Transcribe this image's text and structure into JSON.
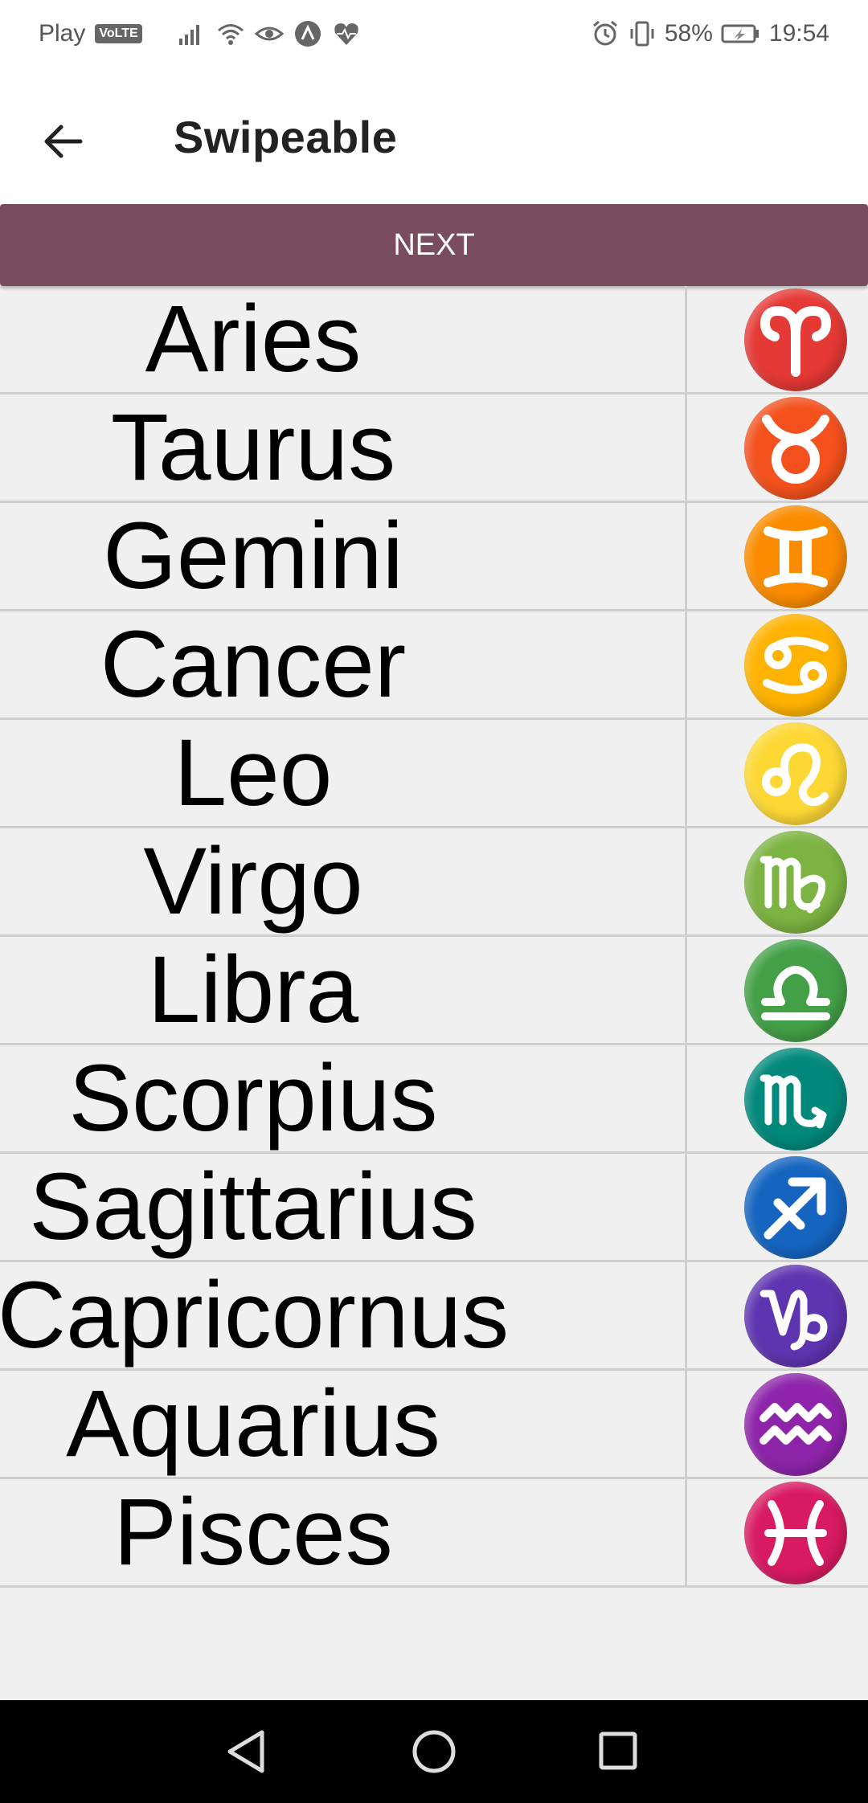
{
  "status_bar": {
    "carrier": "Play",
    "volte": "VoLTE",
    "battery": "58%",
    "time": "19:54",
    "icons": [
      "signal-icon",
      "wifi-icon",
      "eye-icon",
      "app-icon",
      "heart-icon",
      "alarm-icon",
      "vibrate-icon",
      "battery-icon"
    ]
  },
  "app_bar": {
    "title": "Swipeable",
    "back_icon": "arrow-left-icon"
  },
  "next_button": {
    "label": "NEXT",
    "color": "#7a4d5e"
  },
  "signs": [
    {
      "name": "Aries",
      "icon": "aries-icon",
      "color": "#e53935"
    },
    {
      "name": "Taurus",
      "icon": "taurus-icon",
      "color": "#f4511e"
    },
    {
      "name": "Gemini",
      "icon": "gemini-icon",
      "color": "#fb8c00"
    },
    {
      "name": "Cancer",
      "icon": "cancer-icon",
      "color": "#ffb300"
    },
    {
      "name": "Leo",
      "icon": "leo-icon",
      "color": "#fdd835"
    },
    {
      "name": "Virgo",
      "icon": "virgo-icon",
      "color": "#7cb342"
    },
    {
      "name": "Libra",
      "icon": "libra-icon",
      "color": "#43a047"
    },
    {
      "name": "Scorpius",
      "icon": "scorpio-icon",
      "color": "#00897b"
    },
    {
      "name": "Sagittarius",
      "icon": "sagittarius-icon",
      "color": "#1565c0"
    },
    {
      "name": "Capricornus",
      "icon": "capricorn-icon",
      "color": "#5e35b1"
    },
    {
      "name": "Aquarius",
      "icon": "aquarius-icon",
      "color": "#8e24aa"
    },
    {
      "name": "Pisces",
      "icon": "pisces-icon",
      "color": "#d81b60"
    }
  ],
  "nav_bar": {
    "icons": [
      "back-triangle-icon",
      "home-circle-icon",
      "recents-square-icon"
    ]
  }
}
